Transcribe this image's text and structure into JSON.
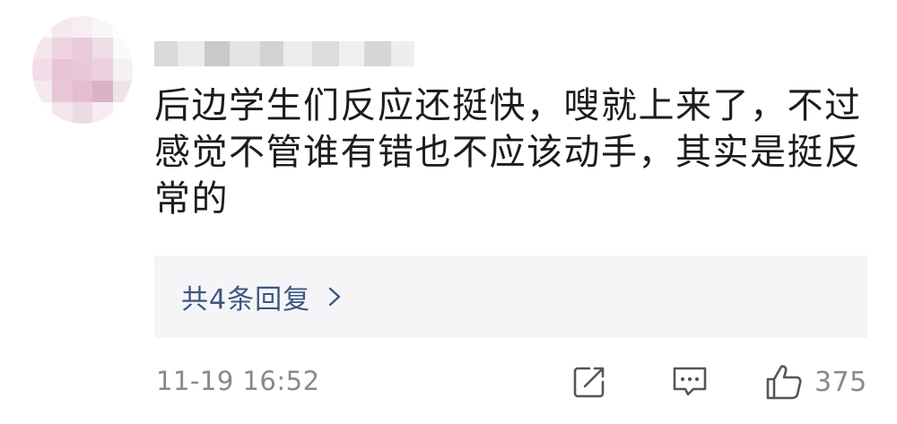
{
  "comment": {
    "author_hidden": true,
    "text": "后边学生们反应还挺快，嗖就上来了，不过\n感觉不管谁有错也不应该动手，其实是挺反\n常的"
  },
  "replies": {
    "label": "共4条回复",
    "chevron_icon": "chevron-right-icon"
  },
  "footer": {
    "timestamp": "11-19 16:52",
    "share_icon": "edit-share-icon",
    "comment_icon": "comment-bubble-icon",
    "like_icon": "thumbs-up-icon",
    "like_count": "375"
  },
  "colors": {
    "text": "#1c1c1c",
    "link": "#3d5680",
    "muted": "#8a8a8a",
    "reply_bg": "#f5f5f7"
  }
}
